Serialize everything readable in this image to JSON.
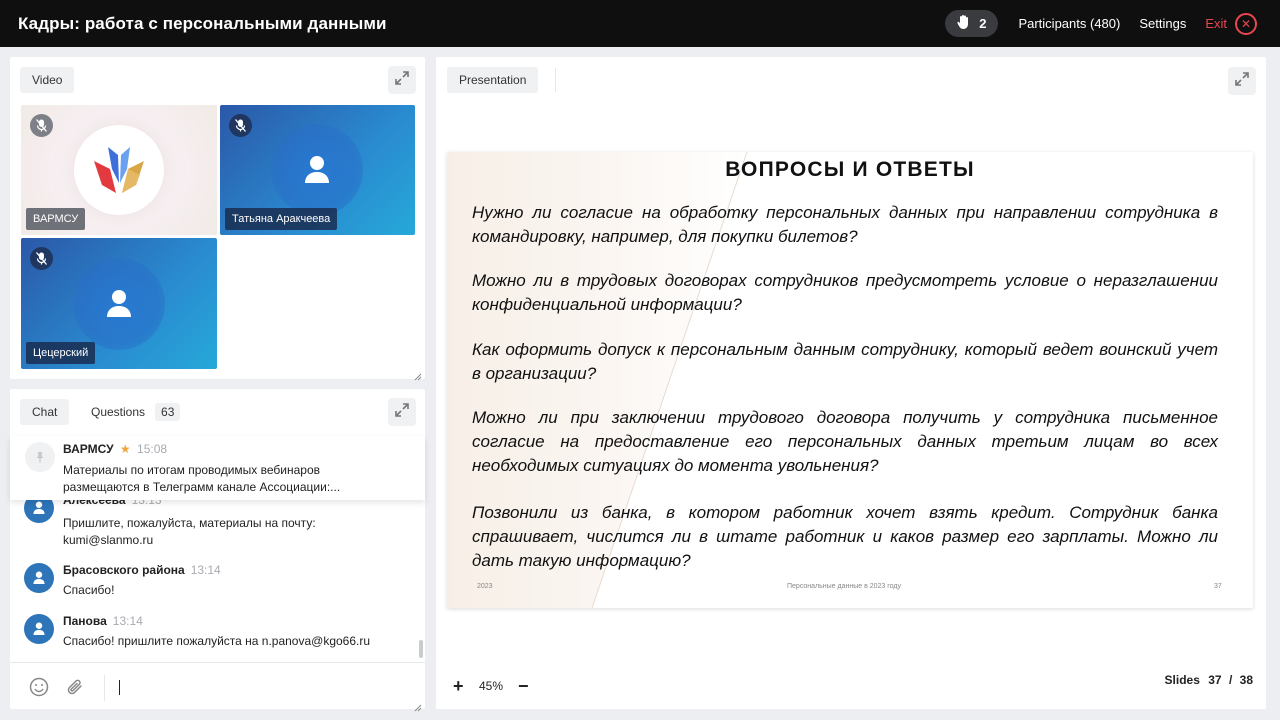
{
  "header": {
    "title": "Кадры: работа с персональными данными",
    "hands_count": "2",
    "participants_label": "Participants (480)",
    "settings_label": "Settings",
    "exit_label": "Exit"
  },
  "video_panel": {
    "tab_label": "Video",
    "tiles": [
      {
        "name": "ВАРМСУ",
        "type": "logo"
      },
      {
        "name": "Татьяна Аракчеева",
        "type": "avatar"
      },
      {
        "name": "Цецерский",
        "type": "avatar"
      }
    ]
  },
  "chat_panel": {
    "tabs": {
      "chat": "Chat",
      "questions": "Questions",
      "questions_count": "63"
    },
    "pinned": {
      "author": "ВАРМСУ",
      "star": "★",
      "time": "15:08",
      "text": "Материалы по итогам проводимых вебинаров размещаются в Телеграмм канале Ассоциации:..."
    },
    "messages": [
      {
        "author": "Алексеева",
        "time": "13:13",
        "text": "Пришлите, пожалуйста, материалы на почту: kumi@slanmo.ru"
      },
      {
        "author": "Брасовского района",
        "time": "13:14",
        "text": "Спасибо!"
      },
      {
        "author": "Панова",
        "time": "13:14",
        "text": "Спасибо! пришлите пожалуйста на n.panova@kgo66.ru"
      }
    ]
  },
  "presentation": {
    "tab_label": "Presentation",
    "slide": {
      "title": "ВОПРОСЫ И ОТВЕТЫ",
      "questions": [
        "Нужно ли согласие на обработку персональных данных при направлении сотрудника в командировку, например, для покупки билетов?",
        "Можно ли в трудовых договорах сотрудников предусмотреть условие о неразглашении конфиденциальной информации?",
        "Как оформить допуск к персональным данным сотруднику, который ведет воинский учет в организации?",
        "Можно ли при заключении трудового договора получить у сотрудника письменное согласие на предоставление его персональных данных третьим лицам во всех необходимых ситуациях до момента увольнения?",
        "Позвонили из банка, в котором работник хочет взять кредит. Сотрудник банка спрашивает, числится ли в штате работник и каков размер его зарплаты. Можно ли дать такую информацию?"
      ],
      "footer_left": "2023",
      "footer_center": "Персональные данные в 2023 году",
      "footer_right": "37"
    },
    "zoom": {
      "plus": "+",
      "level": "45%",
      "minus": "−"
    },
    "slides": {
      "label": "Slides",
      "current": "37",
      "separator": "/",
      "total": "38"
    }
  },
  "colors": {
    "accent_red": "#e8474e",
    "topbar": "#0f0f10",
    "avatar_blue": "#2d74b8"
  }
}
